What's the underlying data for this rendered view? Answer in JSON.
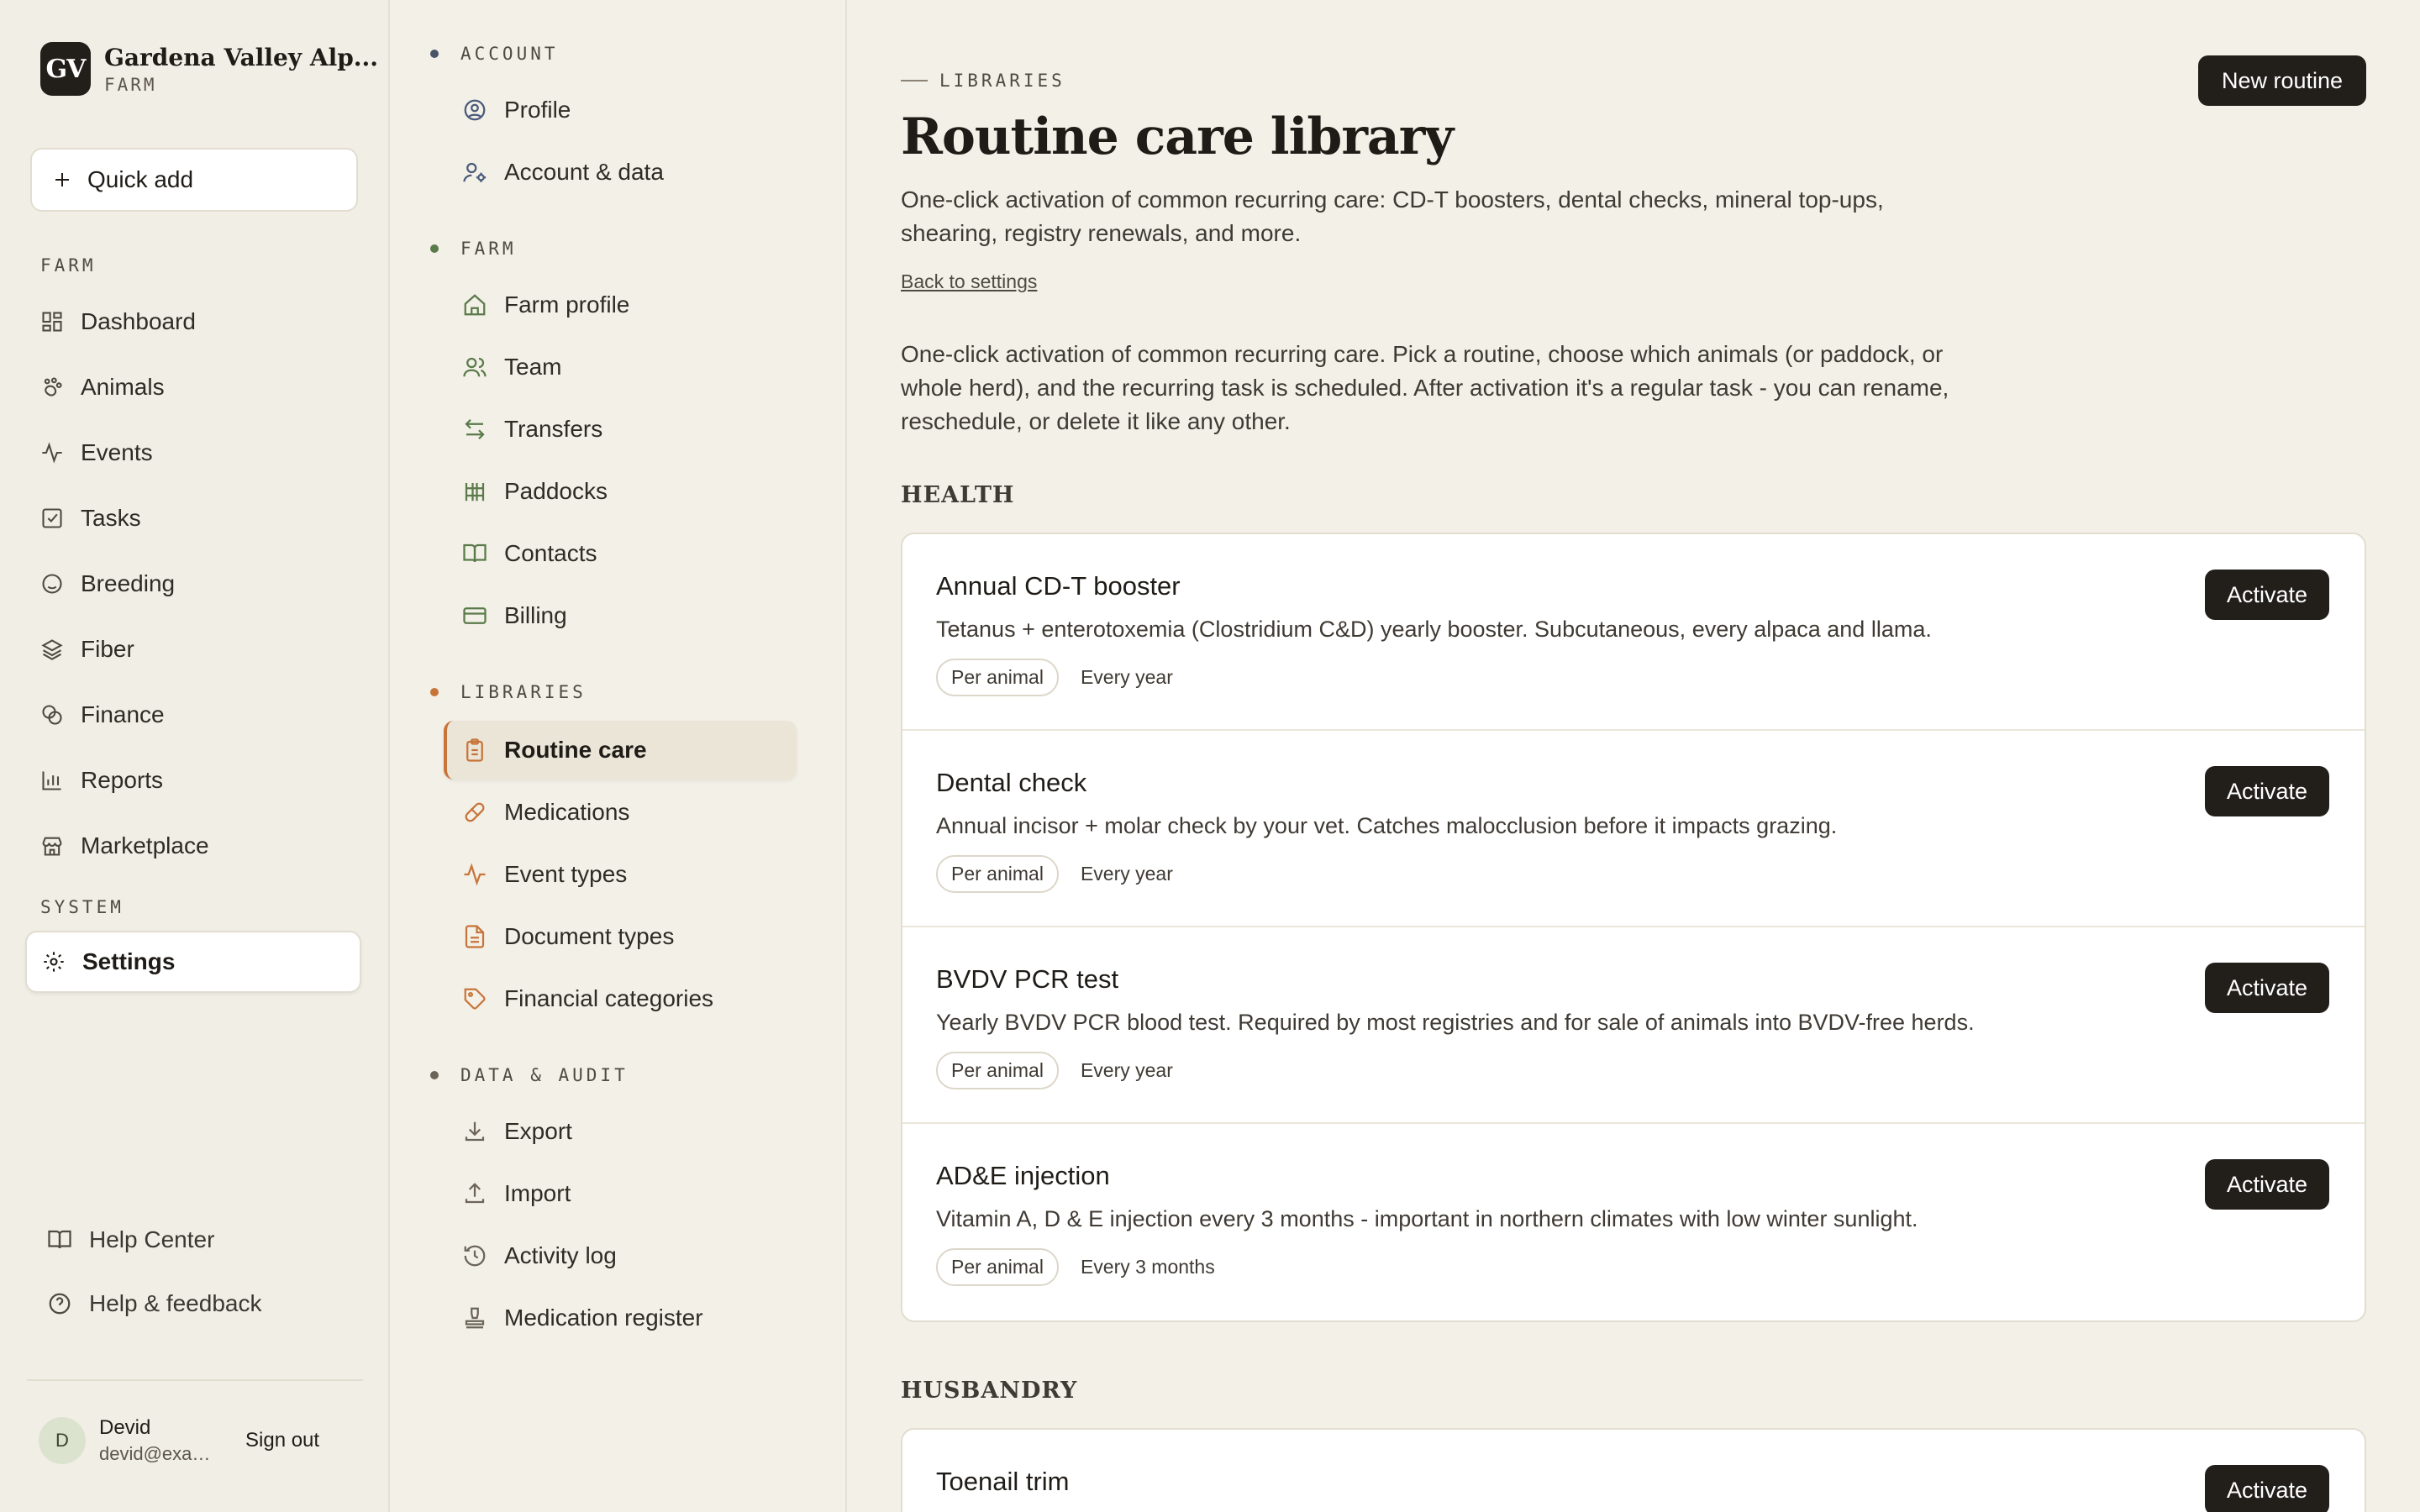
{
  "brand": {
    "initials": "GV",
    "name": "Gardena Valley Alp...",
    "sub": "FARM"
  },
  "quick_add": "Quick add",
  "sidebar": {
    "farm_section": "FARM",
    "items": [
      {
        "label": "Dashboard",
        "icon": "dashboard-icon"
      },
      {
        "label": "Animals",
        "icon": "paw-icon"
      },
      {
        "label": "Events",
        "icon": "activity-icon"
      },
      {
        "label": "Tasks",
        "icon": "check-square-icon"
      },
      {
        "label": "Breeding",
        "icon": "heart-icon"
      },
      {
        "label": "Fiber",
        "icon": "layers-icon"
      },
      {
        "label": "Finance",
        "icon": "coins-icon"
      },
      {
        "label": "Reports",
        "icon": "bar-chart-icon"
      },
      {
        "label": "Marketplace",
        "icon": "store-icon"
      }
    ],
    "system_section": "SYSTEM",
    "settings": "Settings",
    "help_center": "Help Center",
    "help_feedback": "Help & feedback",
    "user": {
      "initial": "D",
      "name": "Devid",
      "email": "devid@example.com"
    },
    "sign_out": "Sign out"
  },
  "subnav": {
    "account": {
      "title": "ACCOUNT",
      "items": [
        "Profile",
        "Account & data"
      ]
    },
    "farm": {
      "title": "FARM",
      "items": [
        "Farm profile",
        "Team",
        "Transfers",
        "Paddocks",
        "Contacts",
        "Billing"
      ]
    },
    "libraries": {
      "title": "LIBRARIES",
      "items": [
        "Routine care",
        "Medications",
        "Event types",
        "Document types",
        "Financial categories"
      ]
    },
    "data": {
      "title": "DATA & AUDIT",
      "items": [
        "Export",
        "Import",
        "Activity log",
        "Medication register"
      ]
    },
    "colors": {
      "account": "#4a5568",
      "farm": "#5a7a4a",
      "libraries": "#c7743a",
      "data": "#6b6459"
    }
  },
  "main": {
    "eyebrow": "LIBRARIES",
    "title": "Routine care library",
    "subtitle": "One-click activation of common recurring care: CD-T boosters, dental checks, mineral top-ups, shearing, registry renewals, and more.",
    "back_link": "Back to settings",
    "intro": "One-click activation of common recurring care. Pick a routine, choose which animals (or paddock, or whole herd), and the recurring task is scheduled. After activation it's a regular task - you can rename, reschedule, or delete it like any other.",
    "new_routine": "New routine",
    "activate": "Activate",
    "groups": [
      {
        "title": "HEALTH",
        "routines": [
          {
            "title": "Annual CD-T booster",
            "desc": "Tetanus + enterotoxemia (Clostridium C&D) yearly booster. Subcutaneous, every alpaca and llama.",
            "scope": "Per animal",
            "freq": "Every year"
          },
          {
            "title": "Dental check",
            "desc": "Annual incisor + molar check by your vet. Catches malocclusion before it impacts grazing.",
            "scope": "Per animal",
            "freq": "Every year"
          },
          {
            "title": "BVDV PCR test",
            "desc": "Yearly BVDV PCR blood test. Required by most registries and for sale of animals into BVDV-free herds.",
            "scope": "Per animal",
            "freq": "Every year"
          },
          {
            "title": "AD&E injection",
            "desc": "Vitamin A, D & E injection every 3 months - important in northern climates with low winter sunlight.",
            "scope": "Per animal",
            "freq": "Every 3 months"
          }
        ]
      },
      {
        "title": "HUSBANDRY",
        "routines": [
          {
            "title": "Toenail trim"
          }
        ]
      }
    ]
  }
}
